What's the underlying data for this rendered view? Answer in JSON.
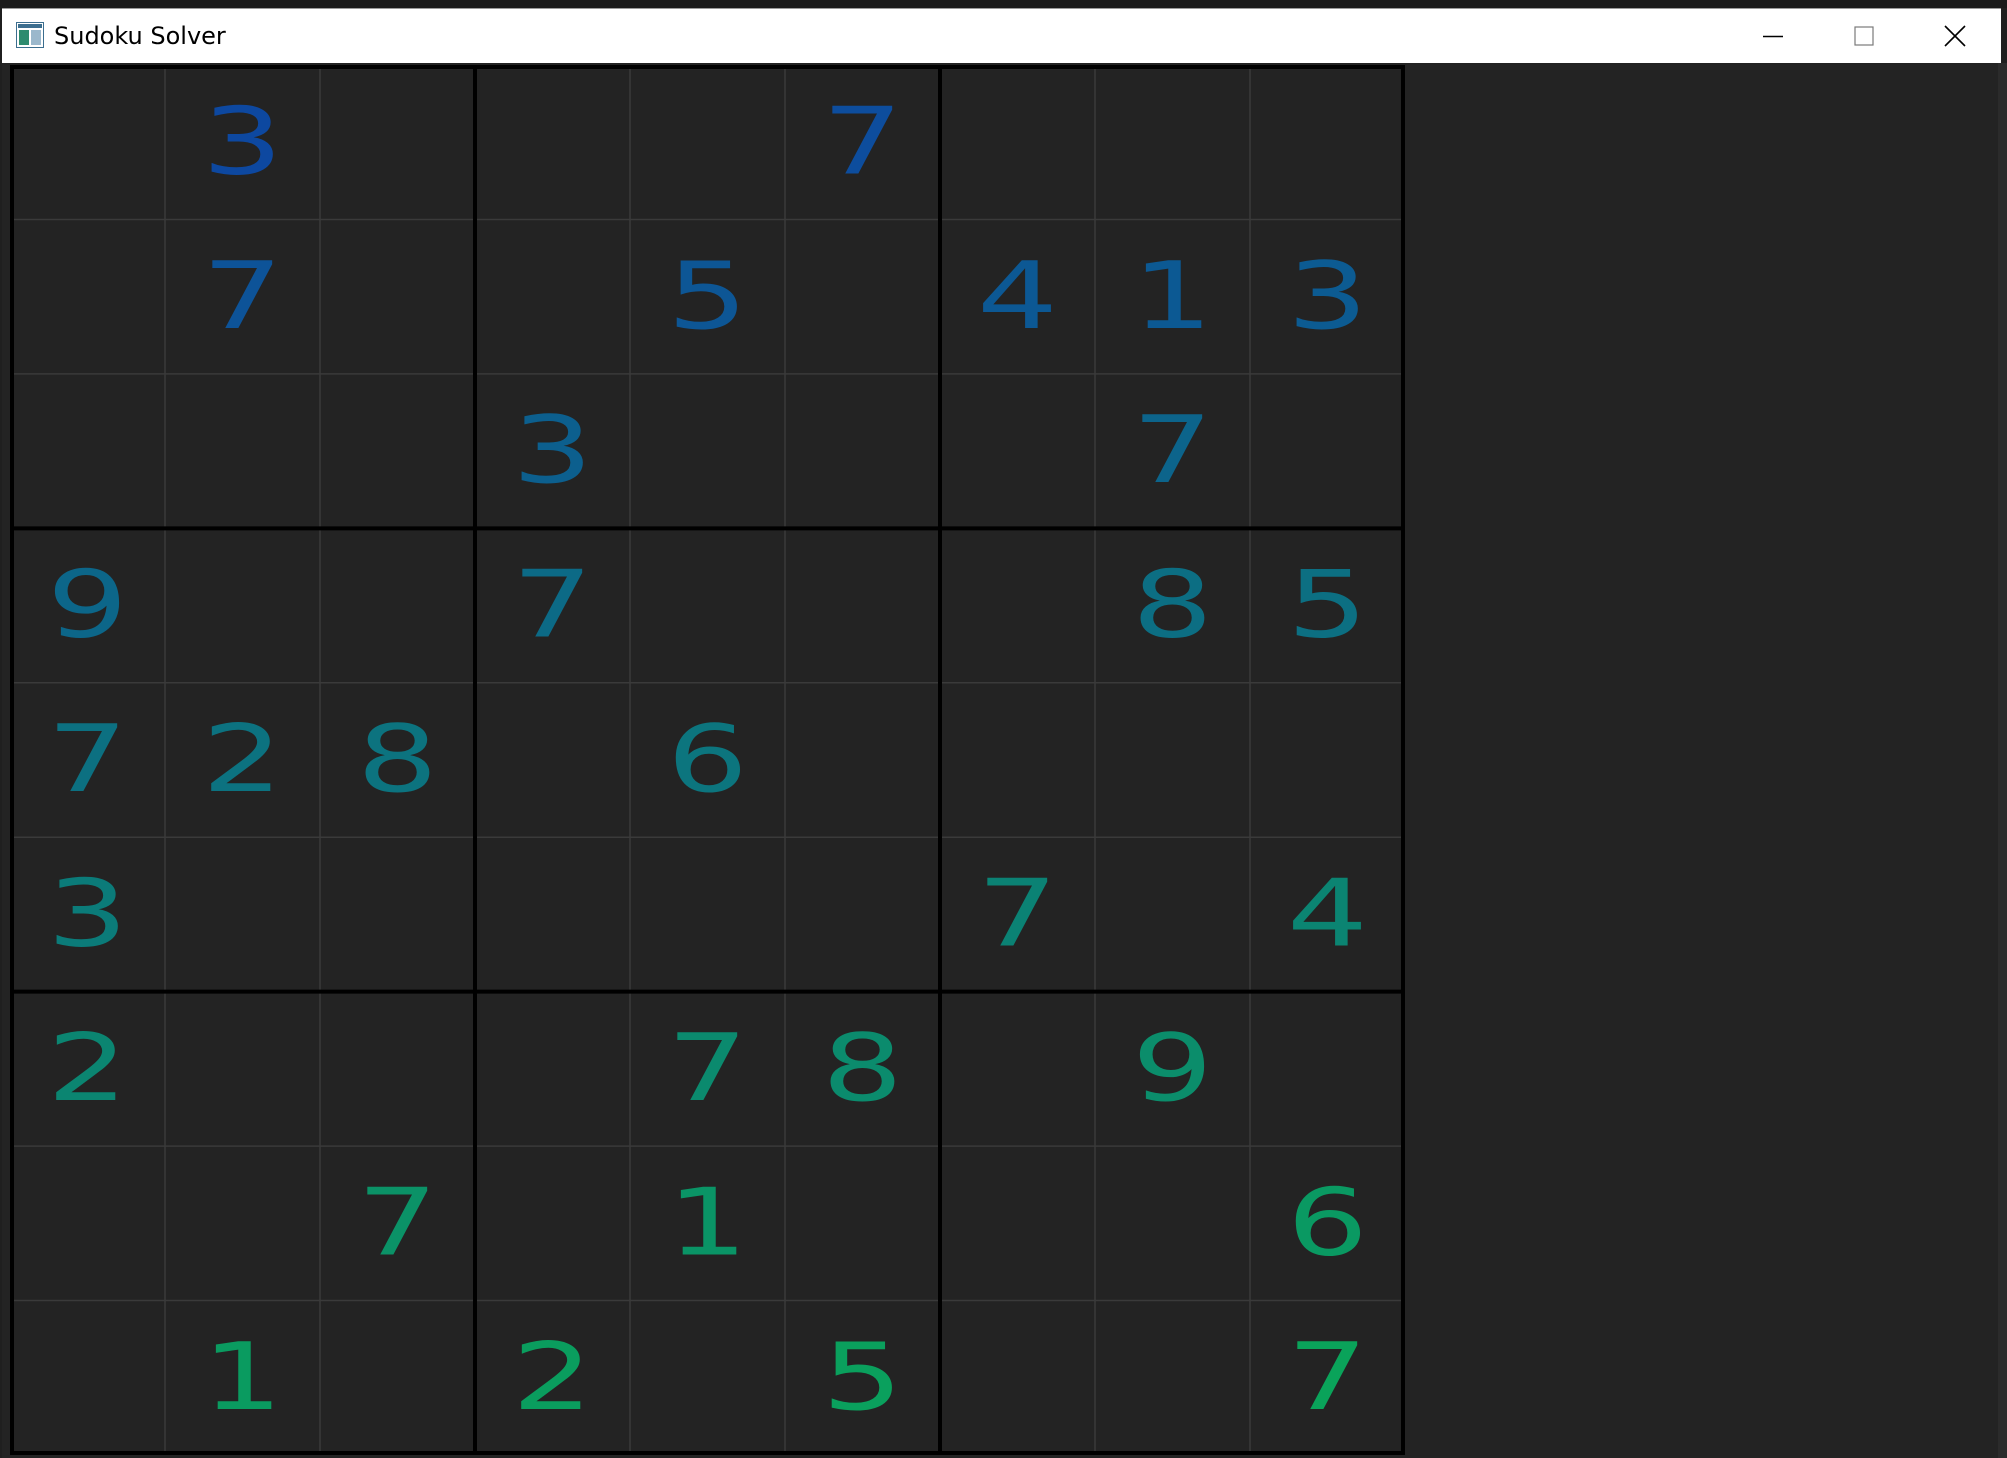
{
  "window": {
    "title": "Sudoku Solver",
    "icon": "app-window-icon",
    "controls": {
      "minimize_icon": "minimize-icon",
      "maximize_icon": "maximize-icon",
      "close_icon": "close-icon"
    }
  },
  "colors": {
    "background": "#232323",
    "grid_line": "#3a3a3a",
    "box_line": "#000000",
    "digit_top": "#0d47a1",
    "digit_bottom": "#0aa35a"
  },
  "board": {
    "size": 9,
    "grid": [
      [
        "",
        "3",
        "",
        "",
        "",
        "7",
        "",
        "",
        ""
      ],
      [
        "",
        "7",
        "",
        "",
        "5",
        "",
        "4",
        "1",
        "3"
      ],
      [
        "",
        "",
        "",
        "3",
        "",
        "",
        "",
        "7",
        ""
      ],
      [
        "9",
        "",
        "",
        "7",
        "",
        "",
        "",
        "8",
        "5"
      ],
      [
        "7",
        "2",
        "8",
        "",
        "6",
        "",
        "",
        "",
        ""
      ],
      [
        "3",
        "",
        "",
        "",
        "",
        "",
        "7",
        "",
        "4"
      ],
      [
        "2",
        "",
        "",
        "",
        "7",
        "8",
        "",
        "9",
        ""
      ],
      [
        "",
        "",
        "7",
        "",
        "1",
        "",
        "",
        "",
        "6"
      ],
      [
        "",
        "1",
        "",
        "2",
        "",
        "5",
        "",
        "",
        "7"
      ]
    ]
  }
}
